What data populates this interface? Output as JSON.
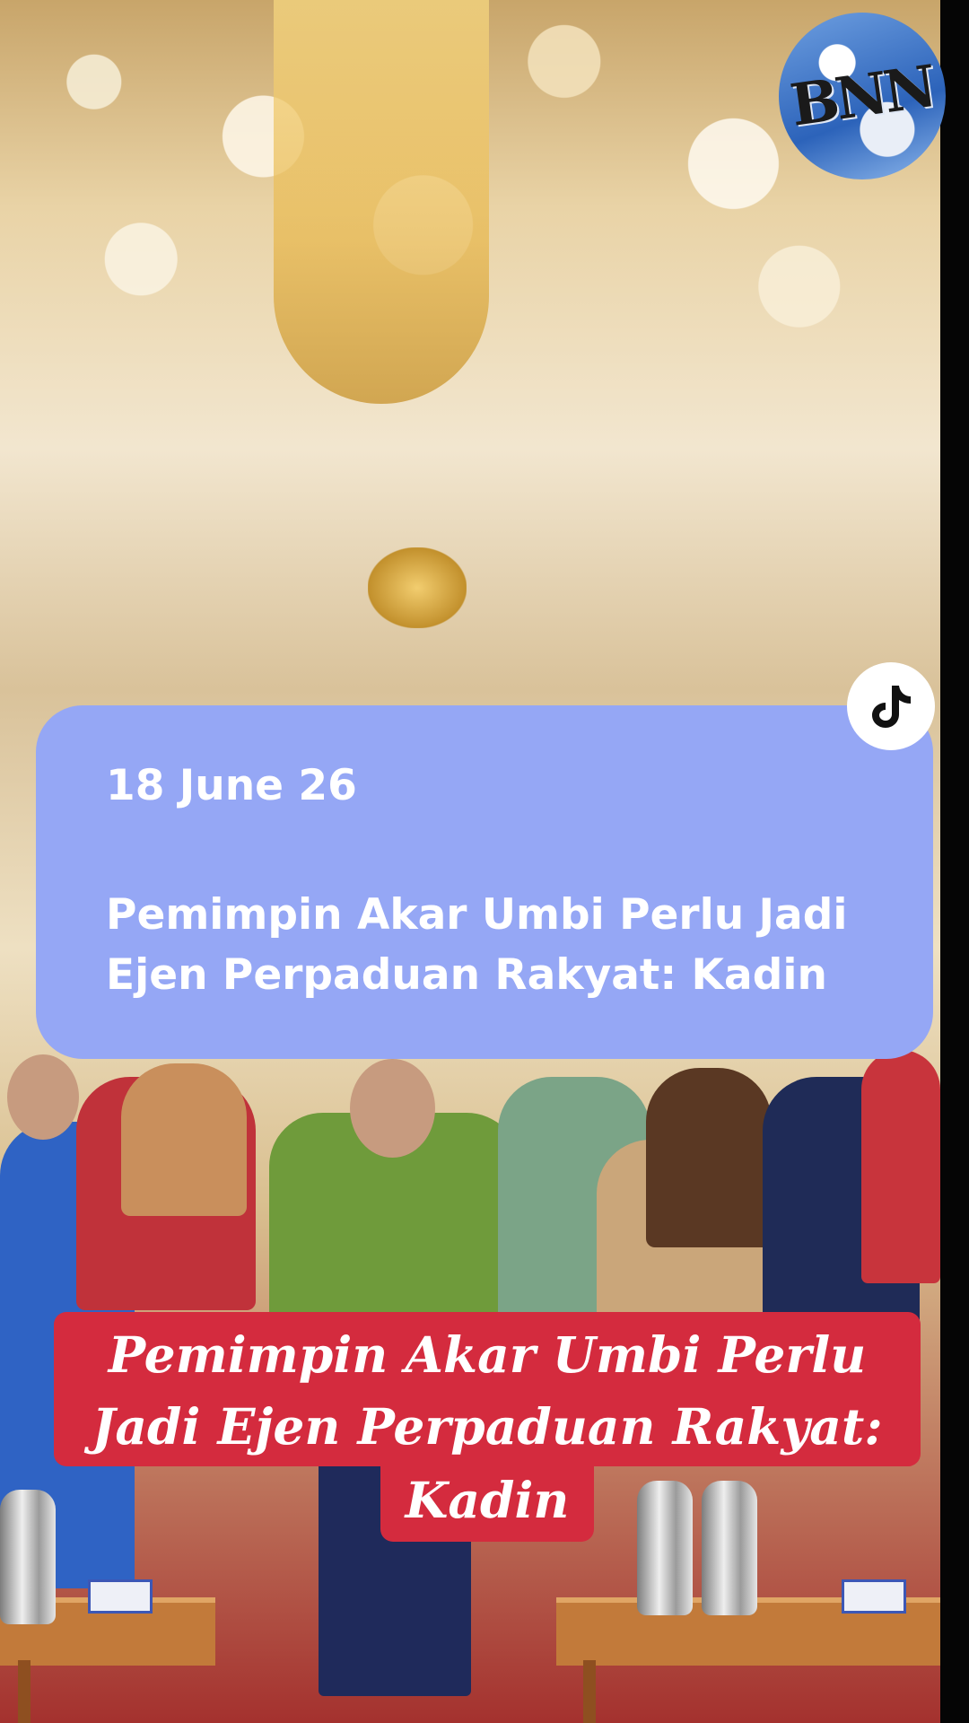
{
  "logo": {
    "text": "BNN"
  },
  "card": {
    "date": "18 June 26",
    "title_line1": "Pemimpin Akar Umbi Perlu Jadi",
    "title_line2": "Ejen Perpaduan Rakyat: Kadin"
  },
  "headline": {
    "line1": "Pemimpin Akar Umbi Perlu",
    "line2": "Jadi Ejen Perpaduan Rakyat:",
    "line3": "Kadin"
  },
  "icons": {
    "brand": "tiktok-icon",
    "logo": "bnn-logo"
  },
  "colors": {
    "card": "#95a7f5",
    "headline_bg": "#d42b3e",
    "text": "#ffffff"
  }
}
